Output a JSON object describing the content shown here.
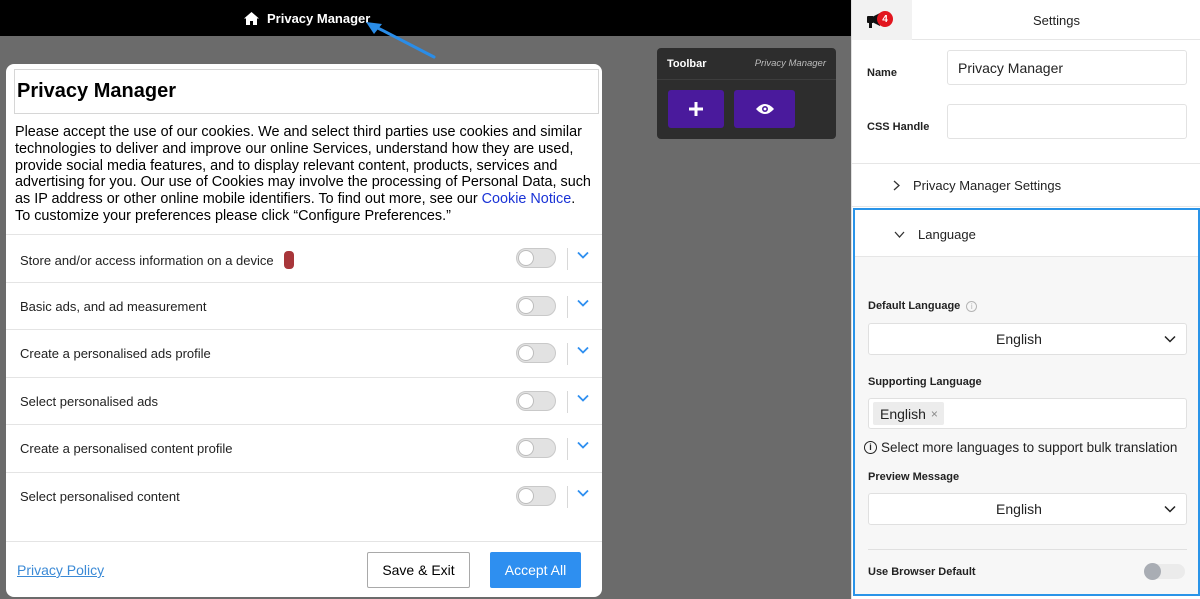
{
  "topbar": {
    "title": "Privacy Manager",
    "icon": "home-icon"
  },
  "toolbar": {
    "title": "Toolbar",
    "subtitle": "Privacy Manager",
    "add_icon": "plus-icon",
    "preview_icon": "eye-icon"
  },
  "modal": {
    "title": "Privacy Manager",
    "body_text": "Please accept the use of our cookies. We and select third parties use cookies and similar technologies to deliver and improve our online Services, understand how they are used, provide social media features, and to display relevant content, products, services and advertising for you. Our use of Cookies may involve the processing of Personal Data, such as IP address or other online mobile identifiers. To find out more, see our ",
    "cookie_link": "Cookie Notice",
    "body_end": ".",
    "body_text_2": "To customize your preferences please click “Configure Preferences.”",
    "purposes": [
      {
        "label": "Store and/or access information on a device"
      },
      {
        "label": "Basic ads, and ad measurement"
      },
      {
        "label": "Create a personalised ads profile"
      },
      {
        "label": "Select personalised ads"
      },
      {
        "label": "Create a personalised content profile"
      },
      {
        "label": "Select personalised content"
      }
    ],
    "footer": {
      "privacy_policy": "Privacy Policy",
      "save_exit": "Save & Exit",
      "accept_all": "Accept All"
    }
  },
  "panel": {
    "notification_count": "4",
    "title": "Settings",
    "name_label": "Name",
    "name_value": "Privacy Manager",
    "css_label": "CSS Handle",
    "css_value": "",
    "pm_settings": "Privacy Manager Settings",
    "language": {
      "title": "Language",
      "default_label": "Default Language",
      "default_value": "English",
      "supporting_label": "Supporting Language",
      "supporting_chip": "English",
      "hint": "Select more languages to support bulk translation",
      "preview_label": "Preview Message",
      "preview_value": "English",
      "browser_default_label": "Use Browser Default"
    }
  },
  "colors": {
    "accent_blue": "#2a94e8",
    "toolbar_button": "#4a1a9c",
    "accept_button": "#2e8ff0",
    "badge_red": "#e2161f"
  }
}
